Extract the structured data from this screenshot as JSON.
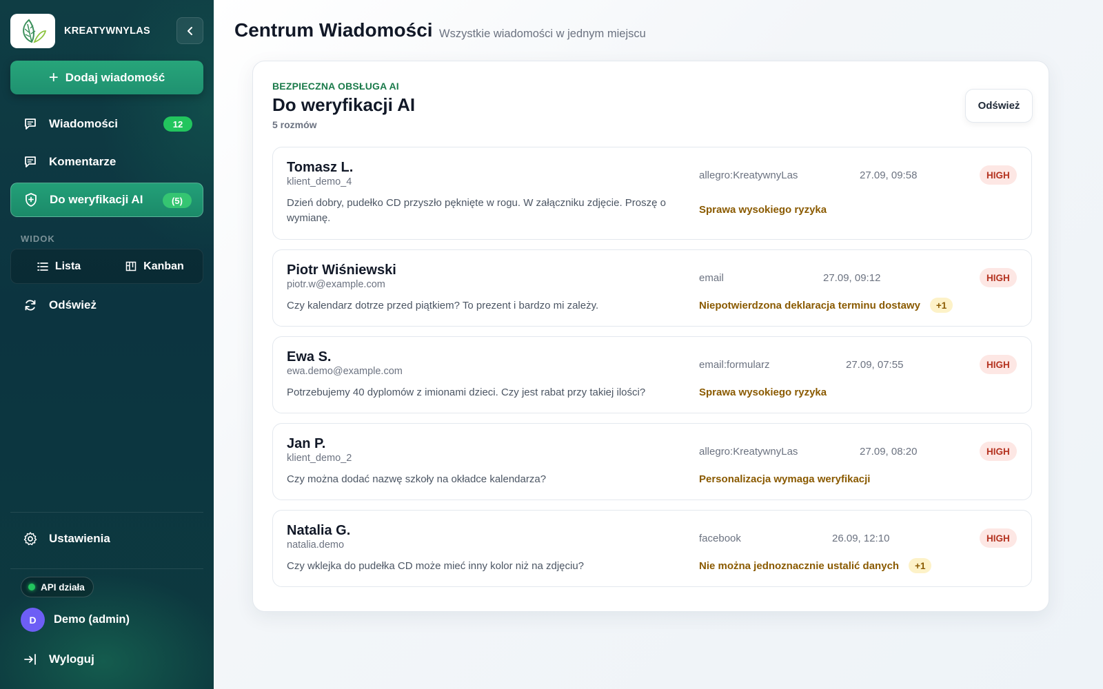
{
  "brand": {
    "name": "KREATYWNYLAS"
  },
  "sidebar": {
    "add_label": "Dodaj wiadomość",
    "items": [
      {
        "label": "Wiadomości",
        "badge": "12",
        "icon": "chat-icon"
      },
      {
        "label": "Komentarze",
        "badge": "",
        "icon": "comment-icon"
      },
      {
        "label": "Do weryfikacji AI",
        "badge": "(5)",
        "icon": "shield-plus-icon"
      }
    ],
    "view_label": "WIDOK",
    "view_options": [
      {
        "label": "Lista",
        "icon": "list-icon"
      },
      {
        "label": "Kanban",
        "icon": "kanban-icon"
      }
    ],
    "refresh_label": "Odśwież",
    "settings_label": "Ustawienia",
    "api_status": "API działa",
    "user": {
      "initial": "D",
      "name": "Demo (admin)"
    },
    "logout_label": "Wyloguj"
  },
  "header": {
    "title": "Centrum Wiadomości",
    "subtitle": "Wszystkie wiadomości w jednym miejscu"
  },
  "panel": {
    "kicker": "BEZPIECZNA OBSŁUGA AI",
    "title": "Do weryfikacji AI",
    "count": "5 rozmów",
    "refresh_label": "Odśwież"
  },
  "conversations": [
    {
      "name": "Tomasz L.",
      "ident": "klient_demo_4",
      "message": "Dzień dobry, pudełko CD przyszło pęknięte w rogu. W załączniku zdjęcie. Proszę o wymianę.",
      "source": "allegro:KreatywnyLas",
      "time": "27.09, 09:58",
      "priority": "HIGH",
      "risk": "Sprawa wysokiego ryzyka",
      "extra": ""
    },
    {
      "name": "Piotr Wiśniewski",
      "ident": "piotr.w@example.com",
      "message": "Czy kalendarz dotrze przed piątkiem? To prezent i bardzo mi zależy.",
      "source": "email",
      "time": "27.09, 09:12",
      "priority": "HIGH",
      "risk": "Niepotwierdzona deklaracja terminu dostawy",
      "extra": "+1"
    },
    {
      "name": "Ewa S.",
      "ident": "ewa.demo@example.com",
      "message": "Potrzebujemy 40 dyplomów z imionami dzieci. Czy jest rabat przy takiej ilości?",
      "source": "email:formularz",
      "time": "27.09, 07:55",
      "priority": "HIGH",
      "risk": "Sprawa wysokiego ryzyka",
      "extra": ""
    },
    {
      "name": "Jan P.",
      "ident": "klient_demo_2",
      "message": "Czy można dodać nazwę szkoły na okładce kalendarza?",
      "source": "allegro:KreatywnyLas",
      "time": "27.09, 08:20",
      "priority": "HIGH",
      "risk": "Personalizacja wymaga weryfikacji",
      "extra": ""
    },
    {
      "name": "Natalia G.",
      "ident": "natalia.demo",
      "message": "Czy wklejka do pudełka CD może mieć inny kolor niż na zdjęciu?",
      "source": "facebook",
      "time": "26.09, 12:10",
      "priority": "HIGH",
      "risk": "Nie można jednoznacznie ustalić danych",
      "extra": "+1"
    }
  ],
  "colors": {
    "accent": "#1f9170",
    "badge": "#22c55e",
    "priority_bg": "#fde7e4",
    "priority_text": "#b4321f",
    "risk_text": "#8a5a00"
  }
}
